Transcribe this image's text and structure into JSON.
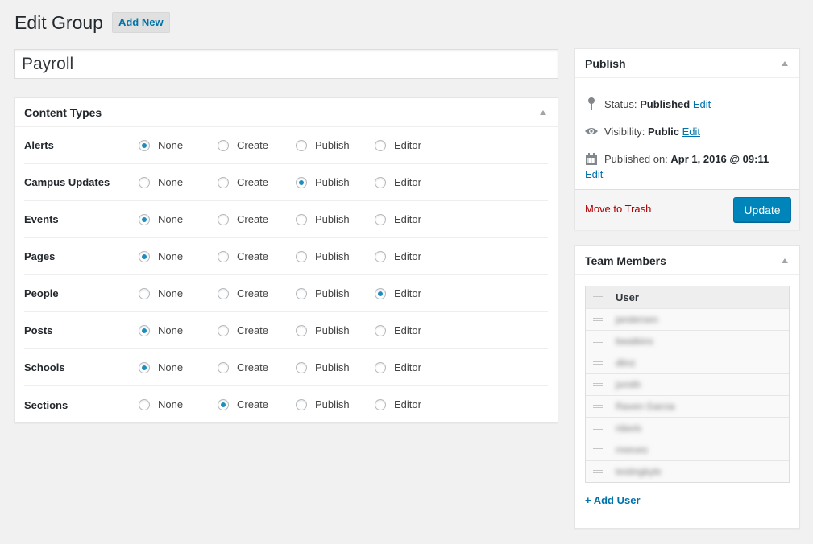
{
  "header": {
    "title": "Edit Group",
    "add_new_label": "Add New"
  },
  "title_field": {
    "value": "Payroll"
  },
  "content_types": {
    "title": "Content Types",
    "options": [
      "None",
      "Create",
      "Publish",
      "Editor"
    ],
    "rows": [
      {
        "label": "Alerts",
        "selected": "None"
      },
      {
        "label": "Campus Updates",
        "selected": "Publish"
      },
      {
        "label": "Events",
        "selected": "None"
      },
      {
        "label": "Pages",
        "selected": "None"
      },
      {
        "label": "People",
        "selected": "Editor"
      },
      {
        "label": "Posts",
        "selected": "None"
      },
      {
        "label": "Schools",
        "selected": "None"
      },
      {
        "label": "Sections",
        "selected": "Create"
      }
    ]
  },
  "publish": {
    "title": "Publish",
    "status_label": "Status:",
    "status_value": "Published",
    "visibility_label": "Visibility:",
    "visibility_value": "Public",
    "published_label": "Published on:",
    "published_value": "Apr 1, 2016 @ 09:11",
    "edit_label": "Edit",
    "trash_label": "Move to Trash",
    "update_label": "Update"
  },
  "team": {
    "title": "Team Members",
    "column_header": "User",
    "users": [
      "jandersen",
      "bwatkins",
      "dlinz",
      "jsmith",
      "Raven Garcia",
      "rdavis",
      "rreeves",
      "testingkyle"
    ],
    "add_user_label": "+ Add User"
  },
  "colors": {
    "accent": "#0073aa",
    "button": "#0085ba",
    "trash": "#aa0000",
    "radio_dot": "#1e8cbe"
  }
}
